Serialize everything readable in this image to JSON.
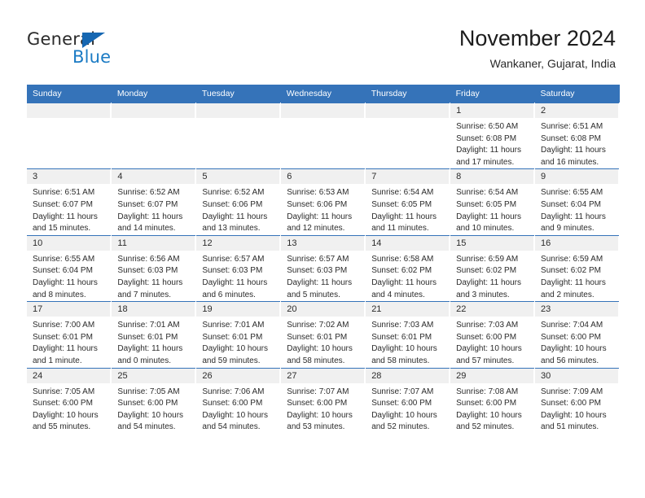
{
  "brand": {
    "name_top": "General",
    "name_bottom": "Blue",
    "accent_color": "#1667b2",
    "blue_text_color": "#1b7bc4"
  },
  "header": {
    "month_title": "November 2024",
    "location": "Wankaner, Gujarat, India"
  },
  "calendar": {
    "header_background": "#3573b9",
    "daynum_band_background": "#f0f0f0",
    "weekday_headers": [
      "Sunday",
      "Monday",
      "Tuesday",
      "Wednesday",
      "Thursday",
      "Friday",
      "Saturday"
    ],
    "weeks": [
      [
        {
          "day": "",
          "lines": []
        },
        {
          "day": "",
          "lines": []
        },
        {
          "day": "",
          "lines": []
        },
        {
          "day": "",
          "lines": []
        },
        {
          "day": "",
          "lines": []
        },
        {
          "day": "1",
          "lines": [
            "Sunrise: 6:50 AM",
            "Sunset: 6:08 PM",
            "Daylight: 11 hours",
            "and 17 minutes."
          ]
        },
        {
          "day": "2",
          "lines": [
            "Sunrise: 6:51 AM",
            "Sunset: 6:08 PM",
            "Daylight: 11 hours",
            "and 16 minutes."
          ]
        }
      ],
      [
        {
          "day": "3",
          "lines": [
            "Sunrise: 6:51 AM",
            "Sunset: 6:07 PM",
            "Daylight: 11 hours",
            "and 15 minutes."
          ]
        },
        {
          "day": "4",
          "lines": [
            "Sunrise: 6:52 AM",
            "Sunset: 6:07 PM",
            "Daylight: 11 hours",
            "and 14 minutes."
          ]
        },
        {
          "day": "5",
          "lines": [
            "Sunrise: 6:52 AM",
            "Sunset: 6:06 PM",
            "Daylight: 11 hours",
            "and 13 minutes."
          ]
        },
        {
          "day": "6",
          "lines": [
            "Sunrise: 6:53 AM",
            "Sunset: 6:06 PM",
            "Daylight: 11 hours",
            "and 12 minutes."
          ]
        },
        {
          "day": "7",
          "lines": [
            "Sunrise: 6:54 AM",
            "Sunset: 6:05 PM",
            "Daylight: 11 hours",
            "and 11 minutes."
          ]
        },
        {
          "day": "8",
          "lines": [
            "Sunrise: 6:54 AM",
            "Sunset: 6:05 PM",
            "Daylight: 11 hours",
            "and 10 minutes."
          ]
        },
        {
          "day": "9",
          "lines": [
            "Sunrise: 6:55 AM",
            "Sunset: 6:04 PM",
            "Daylight: 11 hours",
            "and 9 minutes."
          ]
        }
      ],
      [
        {
          "day": "10",
          "lines": [
            "Sunrise: 6:55 AM",
            "Sunset: 6:04 PM",
            "Daylight: 11 hours",
            "and 8 minutes."
          ]
        },
        {
          "day": "11",
          "lines": [
            "Sunrise: 6:56 AM",
            "Sunset: 6:03 PM",
            "Daylight: 11 hours",
            "and 7 minutes."
          ]
        },
        {
          "day": "12",
          "lines": [
            "Sunrise: 6:57 AM",
            "Sunset: 6:03 PM",
            "Daylight: 11 hours",
            "and 6 minutes."
          ]
        },
        {
          "day": "13",
          "lines": [
            "Sunrise: 6:57 AM",
            "Sunset: 6:03 PM",
            "Daylight: 11 hours",
            "and 5 minutes."
          ]
        },
        {
          "day": "14",
          "lines": [
            "Sunrise: 6:58 AM",
            "Sunset: 6:02 PM",
            "Daylight: 11 hours",
            "and 4 minutes."
          ]
        },
        {
          "day": "15",
          "lines": [
            "Sunrise: 6:59 AM",
            "Sunset: 6:02 PM",
            "Daylight: 11 hours",
            "and 3 minutes."
          ]
        },
        {
          "day": "16",
          "lines": [
            "Sunrise: 6:59 AM",
            "Sunset: 6:02 PM",
            "Daylight: 11 hours",
            "and 2 minutes."
          ]
        }
      ],
      [
        {
          "day": "17",
          "lines": [
            "Sunrise: 7:00 AM",
            "Sunset: 6:01 PM",
            "Daylight: 11 hours",
            "and 1 minute."
          ]
        },
        {
          "day": "18",
          "lines": [
            "Sunrise: 7:01 AM",
            "Sunset: 6:01 PM",
            "Daylight: 11 hours",
            "and 0 minutes."
          ]
        },
        {
          "day": "19",
          "lines": [
            "Sunrise: 7:01 AM",
            "Sunset: 6:01 PM",
            "Daylight: 10 hours",
            "and 59 minutes."
          ]
        },
        {
          "day": "20",
          "lines": [
            "Sunrise: 7:02 AM",
            "Sunset: 6:01 PM",
            "Daylight: 10 hours",
            "and 58 minutes."
          ]
        },
        {
          "day": "21",
          "lines": [
            "Sunrise: 7:03 AM",
            "Sunset: 6:01 PM",
            "Daylight: 10 hours",
            "and 58 minutes."
          ]
        },
        {
          "day": "22",
          "lines": [
            "Sunrise: 7:03 AM",
            "Sunset: 6:00 PM",
            "Daylight: 10 hours",
            "and 57 minutes."
          ]
        },
        {
          "day": "23",
          "lines": [
            "Sunrise: 7:04 AM",
            "Sunset: 6:00 PM",
            "Daylight: 10 hours",
            "and 56 minutes."
          ]
        }
      ],
      [
        {
          "day": "24",
          "lines": [
            "Sunrise: 7:05 AM",
            "Sunset: 6:00 PM",
            "Daylight: 10 hours",
            "and 55 minutes."
          ]
        },
        {
          "day": "25",
          "lines": [
            "Sunrise: 7:05 AM",
            "Sunset: 6:00 PM",
            "Daylight: 10 hours",
            "and 54 minutes."
          ]
        },
        {
          "day": "26",
          "lines": [
            "Sunrise: 7:06 AM",
            "Sunset: 6:00 PM",
            "Daylight: 10 hours",
            "and 54 minutes."
          ]
        },
        {
          "day": "27",
          "lines": [
            "Sunrise: 7:07 AM",
            "Sunset: 6:00 PM",
            "Daylight: 10 hours",
            "and 53 minutes."
          ]
        },
        {
          "day": "28",
          "lines": [
            "Sunrise: 7:07 AM",
            "Sunset: 6:00 PM",
            "Daylight: 10 hours",
            "and 52 minutes."
          ]
        },
        {
          "day": "29",
          "lines": [
            "Sunrise: 7:08 AM",
            "Sunset: 6:00 PM",
            "Daylight: 10 hours",
            "and 52 minutes."
          ]
        },
        {
          "day": "30",
          "lines": [
            "Sunrise: 7:09 AM",
            "Sunset: 6:00 PM",
            "Daylight: 10 hours",
            "and 51 minutes."
          ]
        }
      ]
    ]
  }
}
